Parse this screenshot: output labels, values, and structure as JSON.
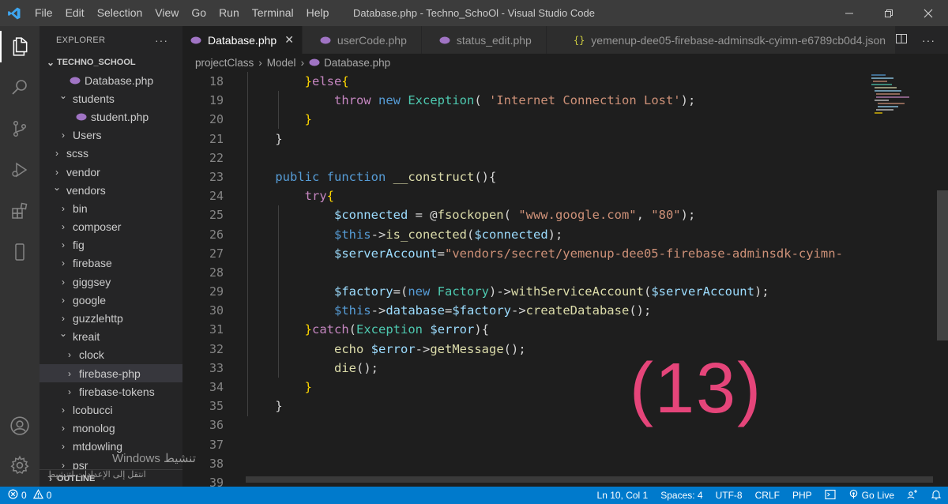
{
  "titlebar": {
    "menu": [
      "File",
      "Edit",
      "Selection",
      "View",
      "Go",
      "Run",
      "Terminal",
      "Help"
    ],
    "title": "Database.php - Techno_SchoOl - Visual Studio Code"
  },
  "sidebar": {
    "header": "EXPLORER",
    "more": "···",
    "project": "TECHNO_SCHOOL",
    "items": [
      {
        "label": "Database.php",
        "type": "php",
        "indent": 1
      },
      {
        "label": "students",
        "type": "folder-open",
        "indent": 1
      },
      {
        "label": "student.php",
        "type": "php",
        "indent": 2
      },
      {
        "label": "Users",
        "type": "folder",
        "indent": 1
      },
      {
        "label": "scss",
        "type": "folder",
        "indent": 0
      },
      {
        "label": "vendor",
        "type": "folder",
        "indent": 0
      },
      {
        "label": "vendors",
        "type": "folder-open",
        "indent": 0
      },
      {
        "label": "bin",
        "type": "folder",
        "indent": 1
      },
      {
        "label": "composer",
        "type": "folder",
        "indent": 1
      },
      {
        "label": "fig",
        "type": "folder",
        "indent": 1
      },
      {
        "label": "firebase",
        "type": "folder",
        "indent": 1
      },
      {
        "label": "giggsey",
        "type": "folder",
        "indent": 1
      },
      {
        "label": "google",
        "type": "folder",
        "indent": 1
      },
      {
        "label": "guzzlehttp",
        "type": "folder",
        "indent": 1
      },
      {
        "label": "kreait",
        "type": "folder-open",
        "indent": 1
      },
      {
        "label": "clock",
        "type": "folder",
        "indent": 2
      },
      {
        "label": "firebase-php",
        "type": "folder",
        "indent": 2,
        "selected": true
      },
      {
        "label": "firebase-tokens",
        "type": "folder",
        "indent": 2
      },
      {
        "label": "lcobucci",
        "type": "folder",
        "indent": 1
      },
      {
        "label": "monolog",
        "type": "folder",
        "indent": 1
      },
      {
        "label": "mtdowling",
        "type": "folder",
        "indent": 1
      },
      {
        "label": "psr",
        "type": "folder",
        "indent": 1
      }
    ],
    "outline": "OUTLINE"
  },
  "tabs": [
    {
      "label": "Database.php",
      "icon": "php",
      "active": true,
      "close": "✕"
    },
    {
      "label": "userCode.php",
      "icon": "php",
      "active": false
    },
    {
      "label": "status_edit.php",
      "icon": "php",
      "active": false
    },
    {
      "label": "yemenup-dee05-firebase-adminsdk-cyimn-e6789cb0d4.json",
      "icon": "json",
      "active": false
    }
  ],
  "breadcrumb": [
    "projectClass",
    "Model",
    "Database.php"
  ],
  "editor": {
    "line_numbers": [
      "18",
      "19",
      "20",
      "21",
      "22",
      "23",
      "24",
      "25",
      "26",
      "27",
      "28",
      "29",
      "30",
      "31",
      "32",
      "33",
      "34",
      "35",
      "36",
      "37",
      "38",
      "39"
    ],
    "lines": [
      [
        {
          "t": "        }",
          "c": "tok-brk"
        },
        {
          "t": "else",
          "c": "tok-kw"
        },
        {
          "t": "{",
          "c": "tok-brk"
        }
      ],
      [
        {
          "t": "            ",
          "c": "tok-pl"
        },
        {
          "t": "throw",
          "c": "tok-kw"
        },
        {
          "t": " ",
          "c": "tok-pl"
        },
        {
          "t": "new",
          "c": "tok-st"
        },
        {
          "t": " ",
          "c": "tok-pl"
        },
        {
          "t": "Exception",
          "c": "tok-cls"
        },
        {
          "t": "( ",
          "c": "tok-pl"
        },
        {
          "t": "'Internet Connection Lost'",
          "c": "tok-str"
        },
        {
          "t": ");",
          "c": "tok-pl"
        }
      ],
      [
        {
          "t": "        }",
          "c": "tok-brk"
        }
      ],
      [
        {
          "t": "    }",
          "c": "tok-pl"
        }
      ],
      [],
      [
        {
          "t": "    ",
          "c": "tok-pl"
        },
        {
          "t": "public",
          "c": "tok-st"
        },
        {
          "t": " ",
          "c": "tok-pl"
        },
        {
          "t": "function",
          "c": "tok-st"
        },
        {
          "t": " ",
          "c": "tok-pl"
        },
        {
          "t": "__construct",
          "c": "tok-fn"
        },
        {
          "t": "(){",
          "c": "tok-pl"
        }
      ],
      [
        {
          "t": "        ",
          "c": "tok-pl"
        },
        {
          "t": "try",
          "c": "tok-kw"
        },
        {
          "t": "{",
          "c": "tok-brk"
        }
      ],
      [
        {
          "t": "            ",
          "c": "tok-pl"
        },
        {
          "t": "$connected",
          "c": "tok-var"
        },
        {
          "t": " = @",
          "c": "tok-pl"
        },
        {
          "t": "fsockopen",
          "c": "tok-fn"
        },
        {
          "t": "( ",
          "c": "tok-pl"
        },
        {
          "t": "\"www.google.com\"",
          "c": "tok-str"
        },
        {
          "t": ", ",
          "c": "tok-pl"
        },
        {
          "t": "\"80\"",
          "c": "tok-str"
        },
        {
          "t": ");",
          "c": "tok-pl"
        }
      ],
      [
        {
          "t": "            ",
          "c": "tok-pl"
        },
        {
          "t": "$this",
          "c": "tok-st"
        },
        {
          "t": "->",
          "c": "tok-pl"
        },
        {
          "t": "is_conected",
          "c": "tok-fn"
        },
        {
          "t": "(",
          "c": "tok-pl"
        },
        {
          "t": "$connected",
          "c": "tok-var"
        },
        {
          "t": ");",
          "c": "tok-pl"
        }
      ],
      [
        {
          "t": "            ",
          "c": "tok-pl"
        },
        {
          "t": "$serverAccount",
          "c": "tok-var"
        },
        {
          "t": "=",
          "c": "tok-pl"
        },
        {
          "t": "\"vendors/secret/yemenup-dee05-firebase-adminsdk-cyimn-",
          "c": "tok-str"
        }
      ],
      [],
      [
        {
          "t": "            ",
          "c": "tok-pl"
        },
        {
          "t": "$factory",
          "c": "tok-var"
        },
        {
          "t": "=(",
          "c": "tok-pl"
        },
        {
          "t": "new",
          "c": "tok-st"
        },
        {
          "t": " ",
          "c": "tok-pl"
        },
        {
          "t": "Factory",
          "c": "tok-cls"
        },
        {
          "t": ")->",
          "c": "tok-pl"
        },
        {
          "t": "withServiceAccount",
          "c": "tok-fn"
        },
        {
          "t": "(",
          "c": "tok-pl"
        },
        {
          "t": "$serverAccount",
          "c": "tok-var"
        },
        {
          "t": ");",
          "c": "tok-pl"
        }
      ],
      [
        {
          "t": "            ",
          "c": "tok-pl"
        },
        {
          "t": "$this",
          "c": "tok-st"
        },
        {
          "t": "->",
          "c": "tok-pl"
        },
        {
          "t": "database",
          "c": "tok-var"
        },
        {
          "t": "=",
          "c": "tok-pl"
        },
        {
          "t": "$factory",
          "c": "tok-var"
        },
        {
          "t": "->",
          "c": "tok-pl"
        },
        {
          "t": "createDatabase",
          "c": "tok-fn"
        },
        {
          "t": "();",
          "c": "tok-pl"
        }
      ],
      [
        {
          "t": "        }",
          "c": "tok-brk"
        },
        {
          "t": "catch",
          "c": "tok-kw"
        },
        {
          "t": "(",
          "c": "tok-pl"
        },
        {
          "t": "Exception",
          "c": "tok-cls"
        },
        {
          "t": " ",
          "c": "tok-pl"
        },
        {
          "t": "$error",
          "c": "tok-var"
        },
        {
          "t": "){",
          "c": "tok-pl"
        }
      ],
      [
        {
          "t": "            ",
          "c": "tok-pl"
        },
        {
          "t": "echo",
          "c": "tok-fn"
        },
        {
          "t": " ",
          "c": "tok-pl"
        },
        {
          "t": "$error",
          "c": "tok-var"
        },
        {
          "t": "->",
          "c": "tok-pl"
        },
        {
          "t": "getMessage",
          "c": "tok-fn"
        },
        {
          "t": "();",
          "c": "tok-pl"
        }
      ],
      [
        {
          "t": "            ",
          "c": "tok-pl"
        },
        {
          "t": "die",
          "c": "tok-fn"
        },
        {
          "t": "();",
          "c": "tok-pl"
        }
      ],
      [
        {
          "t": "        }",
          "c": "tok-brk"
        }
      ],
      [
        {
          "t": "    }",
          "c": "tok-pl"
        }
      ],
      [],
      [],
      [],
      []
    ]
  },
  "overlay": {
    "annotation": "(13)",
    "windows_activate_title": "Windows تنشيط",
    "windows_activate_hint": "انتقل إلى الإعدادات لتنشيط"
  },
  "statusbar": {
    "errors": "0",
    "warnings": "0",
    "position": "Ln 10, Col 1",
    "spaces": "Spaces: 4",
    "encoding": "UTF-8",
    "eol": "CRLF",
    "language": "PHP",
    "golive": "Go Live"
  },
  "colors": {
    "accent": "#007acc",
    "annotation": "#e5457a",
    "php_icon": "#a074c4"
  }
}
